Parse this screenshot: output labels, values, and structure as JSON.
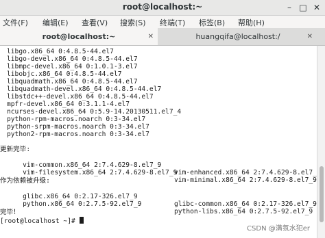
{
  "window": {
    "title": "root@localhost:~",
    "controls": [
      "minimize-icon",
      "maximize-icon",
      "close-icon"
    ]
  },
  "menu": [
    "文件(F)",
    "编辑(E)",
    "查看(V)",
    "搜索(S)",
    "终端(T)",
    "标签(B)",
    "帮助(H)"
  ],
  "tabs": [
    {
      "label": "root@localhost:~",
      "active": true
    },
    {
      "label": "huangqifa@localhost:/",
      "active": false
    }
  ],
  "terminal": {
    "packages": [
      "libgo.x86_64 0:4.8.5-44.el7",
      "libgo-devel.x86_64 0:4.8.5-44.el7",
      "libmpc-devel.x86_64 0:1.0.1-3.el7",
      "libobjc.x86_64 0:4.8.5-44.el7",
      "libquadmath.x86_64 0:4.8.5-44.el7",
      "libquadmath-devel.x86_64 0:4.8.5-44.el7",
      "libstdc++-devel.x86_64 0:4.8.5-44.el7",
      "mpfr-devel.x86_64 0:3.1.1-4.el7",
      "ncurses-devel.x86_64 0:5.9-14.20130511.el7_4",
      "python-rpm-macros.noarch 0:3-34.el7",
      "python-srpm-macros.noarch 0:3-34.el7",
      "python2-rpm-macros.noarch 0:3-34.el7"
    ],
    "updated_header": "更新完毕:",
    "updated": [
      [
        "vim-common.x86_64 2:7.4.629-8.el7_9",
        "vim-enhanced.x86_64 2:7.4.629-8.el7_9"
      ],
      [
        "vim-filesystem.x86_64 2:7.4.629-8.el7_9",
        "vim-minimal.x86_64 2:7.4.629-8.el7_9"
      ]
    ],
    "dep_header": "作为依赖被升级:",
    "dependencies": [
      [
        "glibc.x86_64 0:2.17-326.el7_9",
        "glibc-common.x86_64 0:2.17-326.el7_9"
      ],
      [
        "python.x86_64 0:2.7.5-92.el7_9",
        "python-libs.x86_64 0:2.7.5-92.el7_9"
      ]
    ],
    "complete": "完毕！",
    "prompt": "[root@localhost ~]# "
  },
  "watermark": "CSDN @满氛水犯er"
}
